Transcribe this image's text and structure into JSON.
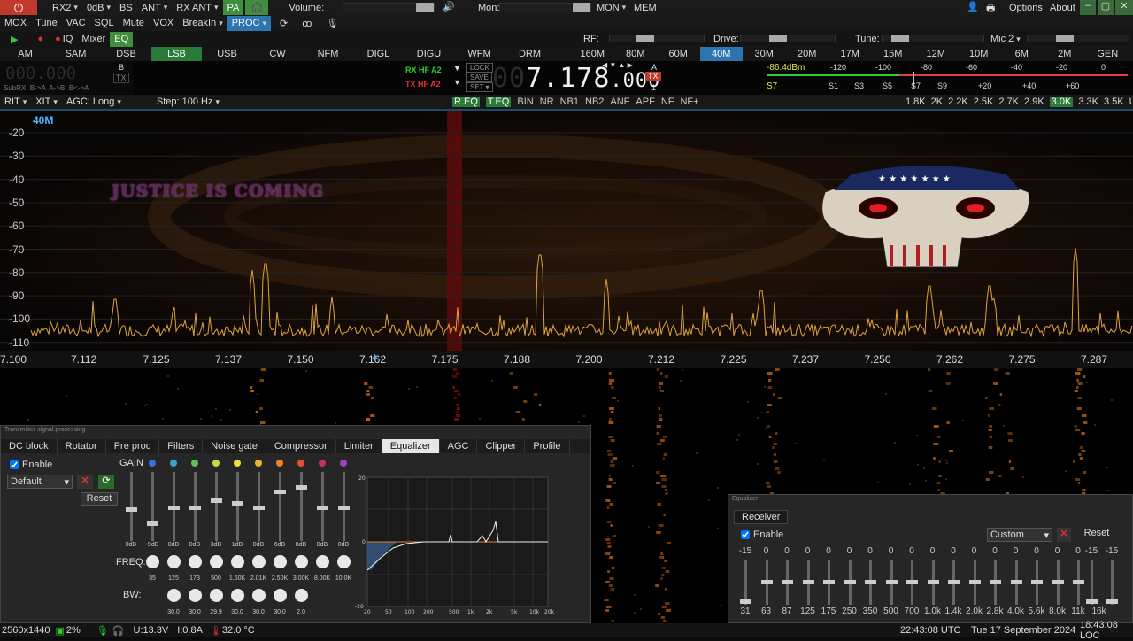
{
  "toolbar1": {
    "rx2": "RX2",
    "db": "0dB",
    "bs": "BS",
    "ant": "ANT",
    "rx_ant": "RX ANT",
    "pa": "PA",
    "volume_label": "Volume:",
    "mon_label": "Mon:",
    "mon": "MON",
    "mem": "MEM",
    "options": "Options",
    "about": "About"
  },
  "toolbar2": {
    "mox": "MOX",
    "tune": "Tune",
    "vac": "VAC",
    "sql": "SQL",
    "mute": "Mute",
    "vox": "VOX",
    "breakin": "BreakIn",
    "proc": "PROC"
  },
  "toolbar3": {
    "iq": "IQ",
    "mixer": "Mixer",
    "eq": "EQ",
    "rf": "RF:",
    "drive": "Drive:",
    "tune_label": "Tune:",
    "mic": "Mic 2"
  },
  "modes": [
    "AM",
    "SAM",
    "DSB",
    "LSB",
    "USB",
    "CW",
    "NFM",
    "DIGL",
    "DIGU",
    "WFM",
    "DRM"
  ],
  "active_mode": "LSB",
  "bands": [
    "160M",
    "80M",
    "60M",
    "40M",
    "30M",
    "20M",
    "17M",
    "15M",
    "12M",
    "10M",
    "6M",
    "2M",
    "GEN"
  ],
  "active_band": "40M",
  "vfo": {
    "subrx_freq": "000.000",
    "subrx_b": "B",
    "subrx_tx": "TX",
    "subrx_row": "SubRX  B->A  A->B  B<->A",
    "rx_ant": "RX HF A2",
    "tx_ant": "TX HF A2",
    "lock": "LOCK",
    "save": "SAVE",
    "set": "SET",
    "freq_dim": "00",
    "freq_main": "7.178",
    "freq_fine": ".000",
    "vfo_a": "A",
    "vfo_tx": "TX",
    "vfo_1": "1"
  },
  "meter": {
    "reading": "-86.4dBm",
    "scale_top": [
      "-120",
      "-100",
      "-80",
      "-60",
      "-40",
      "-20",
      "0"
    ],
    "s_label": "S7",
    "scale_bottom": [
      "S1",
      "S3",
      "S5",
      "S7",
      "S9",
      "+20",
      "+40",
      "+60"
    ]
  },
  "dsp": {
    "rit": "RIT",
    "xit": "XIT",
    "agc": "AGC: Long",
    "step": "Step: 100 Hz",
    "buttons": [
      "R.EQ",
      "T.EQ",
      "BIN",
      "NR",
      "NB1",
      "NB2",
      "ANF",
      "APF",
      "NF",
      "NF+"
    ],
    "active_buttons": [
      "R.EQ",
      "T.EQ"
    ],
    "filters": [
      "1.8K",
      "2K",
      "2.2K",
      "2.5K",
      "2.7K",
      "2.9K",
      "3.0K",
      "3.3K",
      "3.5K",
      "User"
    ],
    "active_filter": "3.0K"
  },
  "panadapter": {
    "band_label": "40M",
    "overlay_text": "JUSTICE IS COMING",
    "db_labels": [
      "-20",
      "-30",
      "-40",
      "-50",
      "-60",
      "-70",
      "-80",
      "-90",
      "-100",
      "-110"
    ],
    "freq_labels": [
      "7.100",
      "7.112",
      "7.125",
      "7.137",
      "7.150",
      "7.162",
      "7.175",
      "7.188",
      "7.200",
      "7.212",
      "7.225",
      "7.237",
      "7.250",
      "7.262",
      "7.275",
      "7.287"
    ]
  },
  "tx_panel": {
    "title": "Transmitter signal processing",
    "tabs": [
      "DC block",
      "Rotator",
      "Pre proc",
      "Filters",
      "Noise gate",
      "Compressor",
      "Limiter",
      "Equalizer",
      "AGC",
      "Clipper",
      "Profile"
    ],
    "active_tab": "Equalizer",
    "enable": "Enable",
    "preset": "Default",
    "reset": "Reset",
    "gain": "GAIN",
    "freq": "FREQ:",
    "bw": "BW:",
    "gains": [
      "0dB",
      "-9dB",
      "0dB",
      "0dB",
      "3dB",
      "1dB",
      "0dB",
      "6dB",
      "8dB",
      "0dB",
      "0dB"
    ],
    "freqs": [
      "35",
      "125",
      "173",
      "500",
      "1.60K",
      "2.01K",
      "2.50K",
      "3.00K",
      "8.00K",
      "10.0K"
    ],
    "bws": [
      "30.0",
      "30.0",
      "29.9",
      "30.0",
      "30.0",
      "30.0",
      "2.0"
    ],
    "dot_colors": [
      "#3a6fd8",
      "#3aa0d8",
      "#5cc05c",
      "#c8d840",
      "#e8e040",
      "#f0b030",
      "#f08030",
      "#e05030",
      "#c03070",
      "#a040c0"
    ],
    "graph_y": [
      "20",
      "0",
      "-20"
    ],
    "graph_x": [
      "20",
      "50",
      "100",
      "200",
      "500",
      "1k",
      "2k",
      "5k",
      "10k",
      "20k"
    ]
  },
  "eq_panel": {
    "title": "Equalizer",
    "tab": "Receiver",
    "enable": "Enable",
    "preset": "Custom",
    "reset": "Reset",
    "values": [
      "-15",
      "0",
      "0",
      "0",
      "0",
      "0",
      "0",
      "0",
      "0",
      "0",
      "0",
      "0",
      "0",
      "0",
      "0",
      "0",
      "0",
      "-15",
      "-15"
    ],
    "bands": [
      "31",
      "63",
      "87",
      "125",
      "175",
      "250",
      "350",
      "500",
      "700",
      "1.0k",
      "1.4k",
      "2.0k",
      "2.8k",
      "4.0k",
      "5.6k",
      "8.0k",
      "11k",
      "16k"
    ]
  },
  "status": {
    "res": "2560x1440",
    "cpu": "2%",
    "voltage": "U:13.3V",
    "current": "I:0.8A",
    "temp": "32.0 °C",
    "utc": "22:43:08 UTC",
    "date": "Tue 17 September 2024",
    "loc": "18:43:08 LOC"
  }
}
